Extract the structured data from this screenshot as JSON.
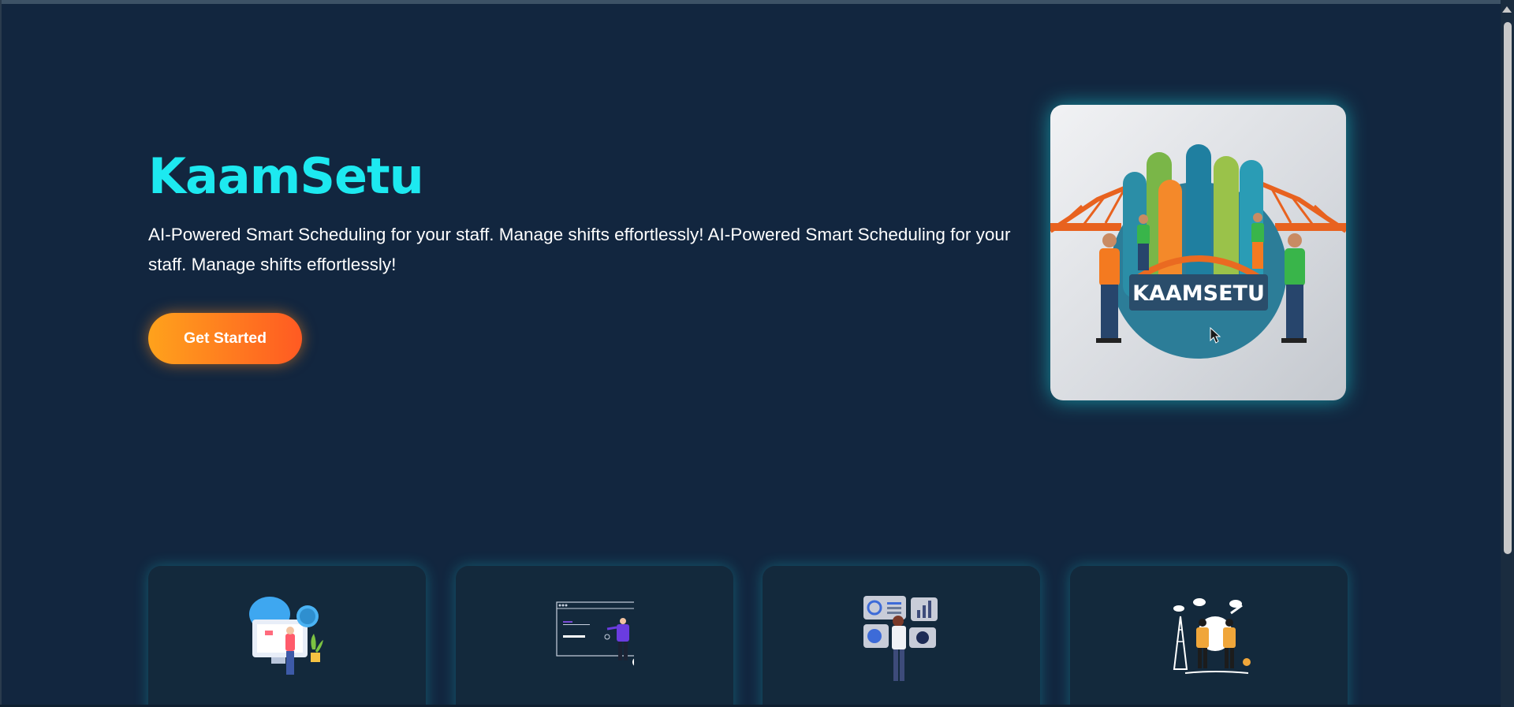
{
  "hero": {
    "title": "KaamSetu",
    "description": "AI-Powered Smart Scheduling for your staff. Manage shifts effortlessly! AI-Powered Smart Scheduling for your staff. Manage shifts effortlessly!",
    "cta_label": "Get Started",
    "image_logo_text": "KAAMSETU"
  },
  "features": [
    {
      "icon": "scheduling-illustration-icon"
    },
    {
      "icon": "task-board-illustration-icon"
    },
    {
      "icon": "analytics-dashboard-illustration-icon"
    },
    {
      "icon": "team-network-illustration-icon"
    }
  ],
  "colors": {
    "background": "#12263f",
    "accent_title": "#1de9f0",
    "cta_gradient_start": "#ffa21c",
    "cta_gradient_end": "#ff5a22",
    "text": "#ffffff"
  }
}
